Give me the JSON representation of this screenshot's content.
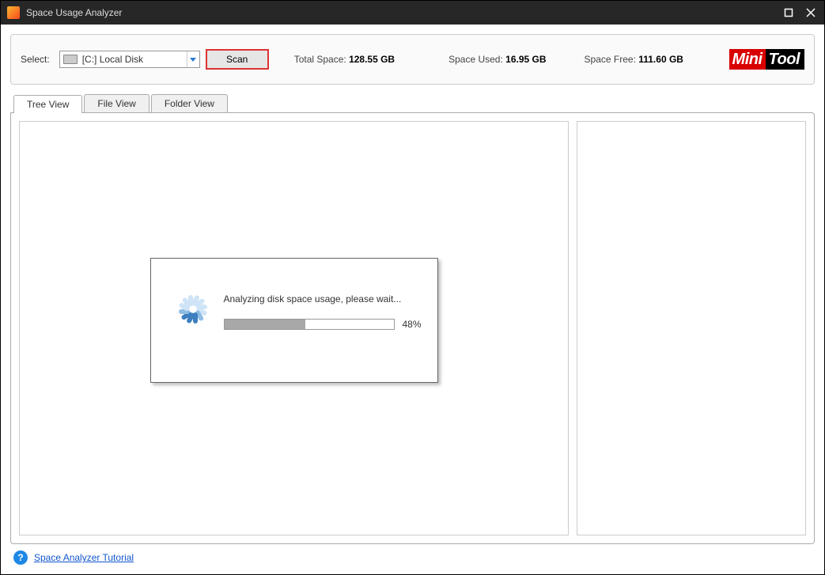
{
  "window": {
    "title": "Space Usage Analyzer"
  },
  "toolbar": {
    "select_label": "Select:",
    "drive_selected": "[C:] Local Disk",
    "scan_label": "Scan",
    "total_label": "Total Space: ",
    "total_value": "128.55 GB",
    "used_label": "Space Used: ",
    "used_value": "16.95 GB",
    "free_label": "Space Free: ",
    "free_value": "111.60 GB",
    "logo_left": "Mini",
    "logo_right": "Tool"
  },
  "tabs": [
    {
      "label": "Tree View",
      "active": true
    },
    {
      "label": "File View",
      "active": false
    },
    {
      "label": "Folder View",
      "active": false
    }
  ],
  "dialog": {
    "message": "Analyzing disk space usage, please wait...",
    "percent": 48,
    "percent_label": "48%"
  },
  "footer": {
    "tutorial_link": "Space Analyzer Tutorial"
  },
  "colors": {
    "accent_red": "#d90000",
    "link_blue": "#1155cc"
  }
}
